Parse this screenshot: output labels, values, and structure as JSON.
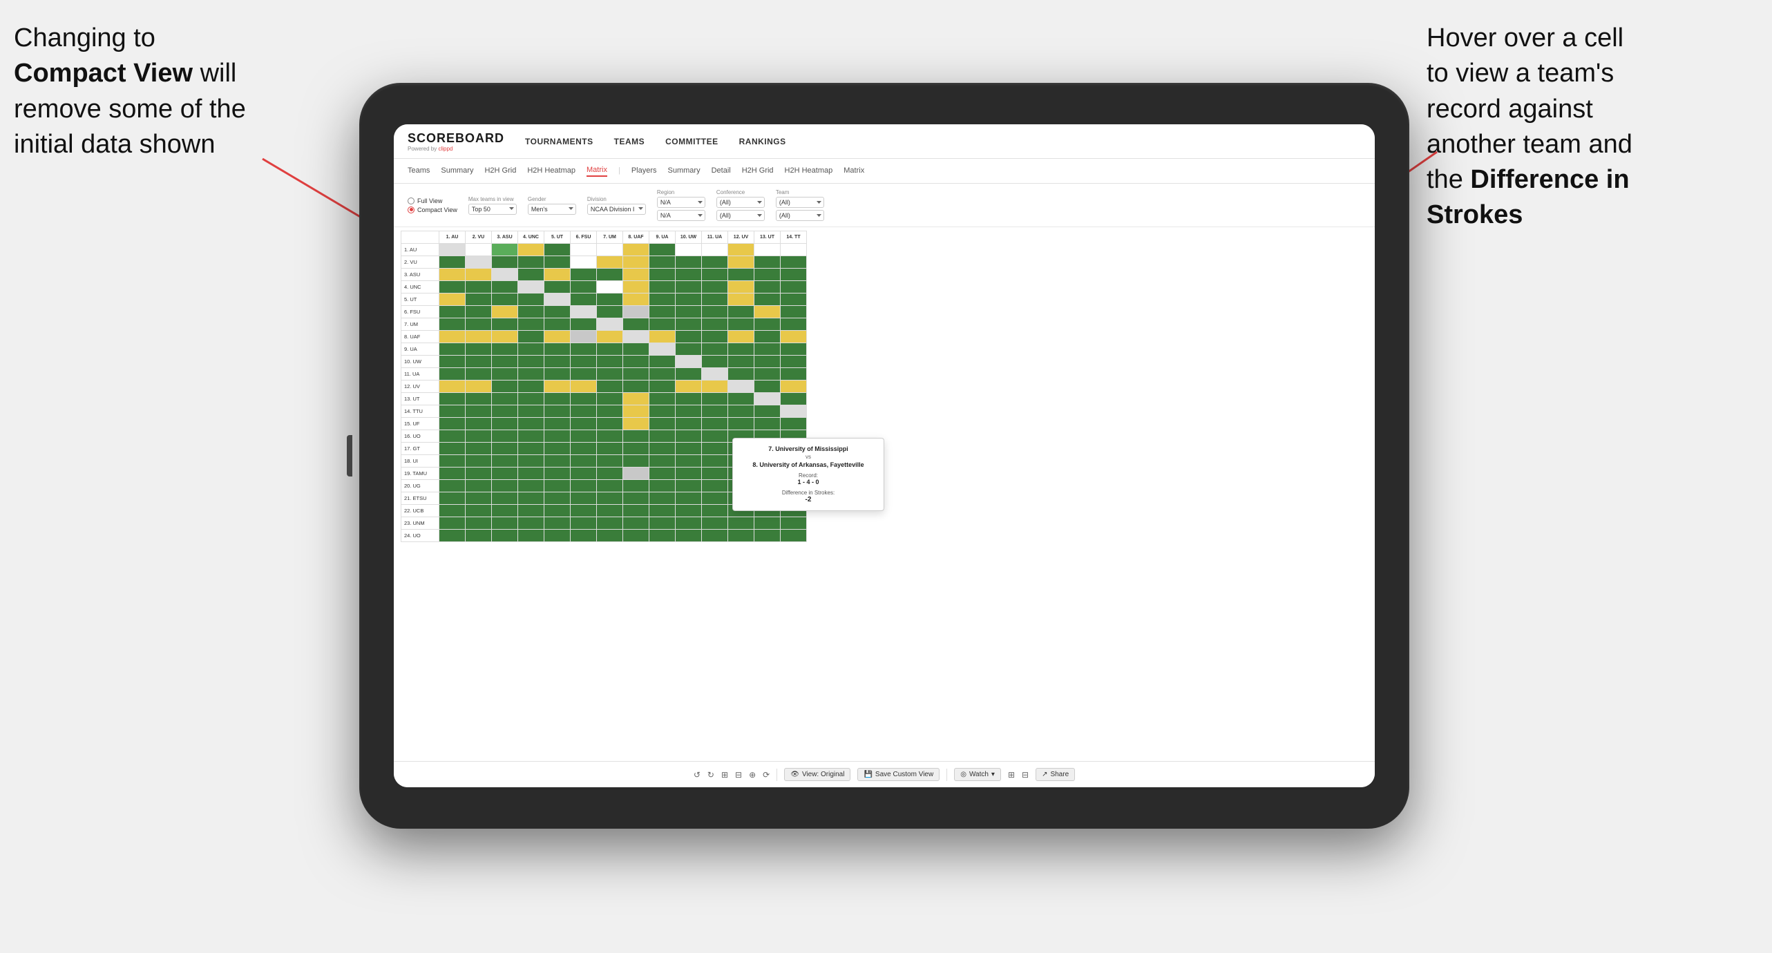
{
  "annotations": {
    "left": {
      "line1": "Changing to",
      "line2_bold": "Compact View",
      "line2_rest": " will",
      "line3": "remove some of the",
      "line4": "initial data shown"
    },
    "right": {
      "line1": "Hover over a cell",
      "line2": "to view a team's",
      "line3": "record against",
      "line4": "another team and",
      "line5_pre": "the ",
      "line5_bold": "Difference in",
      "line6_bold": "Strokes"
    }
  },
  "app": {
    "logo": "SCOREBOARD",
    "logo_sub_pre": "Powered by ",
    "logo_sub_brand": "clippd",
    "nav": [
      "TOURNAMENTS",
      "TEAMS",
      "COMMITTEE",
      "RANKINGS"
    ]
  },
  "sub_nav": {
    "groups": [
      {
        "label": "Teams"
      },
      {
        "label": "Summary"
      },
      {
        "label": "H2H Grid"
      },
      {
        "label": "H2H Heatmap"
      },
      {
        "label": "Matrix",
        "active": true
      },
      {
        "label": "Players"
      },
      {
        "label": "Summary"
      },
      {
        "label": "Detail"
      },
      {
        "label": "H2H Grid"
      },
      {
        "label": "H2H Heatmap"
      },
      {
        "label": "Matrix"
      }
    ]
  },
  "controls": {
    "view_options": {
      "full_view": "Full View",
      "compact_view": "Compact View",
      "selected": "compact"
    },
    "filters": [
      {
        "label": "Max teams in view",
        "value": "Top 50"
      },
      {
        "label": "Gender",
        "value": "Men's"
      },
      {
        "label": "Division",
        "value": "NCAA Division I"
      },
      {
        "label": "Region",
        "value": "N/A",
        "value2": "N/A"
      },
      {
        "label": "Conference",
        "value": "(All)",
        "value2": "(All)"
      },
      {
        "label": "Team",
        "value": "(All)",
        "value2": "(All)"
      }
    ]
  },
  "matrix": {
    "col_headers": [
      "1. AU",
      "2. VU",
      "3. ASU",
      "4. UNC",
      "5. UT",
      "6. FSU",
      "7. UM",
      "8. UAF",
      "9. UA",
      "10. UW",
      "11. UA",
      "12. UV",
      "13. UT",
      "14. TT"
    ],
    "row_headers": [
      "1. AU",
      "2. VU",
      "3. ASU",
      "4. UNC",
      "5. UT",
      "6. FSU",
      "7. UM",
      "8. UAF",
      "9. UA",
      "10. UW",
      "11. UA",
      "12. UV",
      "13. UT",
      "14. TTU",
      "15. UF",
      "16. UO",
      "17. GT",
      "18. UI",
      "19. TAMU",
      "20. UG",
      "21. ETSU",
      "22. UCB",
      "23. UNM",
      "24. UO"
    ]
  },
  "tooltip": {
    "team1": "7. University of Mississippi",
    "vs": "vs",
    "team2": "8. University of Arkansas, Fayetteville",
    "record_label": "Record:",
    "record_value": "1 - 4 - 0",
    "strokes_label": "Difference in Strokes:",
    "strokes_value": "-2"
  },
  "toolbar": {
    "view_original": "View: Original",
    "save_custom": "Save Custom View",
    "watch": "Watch",
    "share": "Share"
  }
}
